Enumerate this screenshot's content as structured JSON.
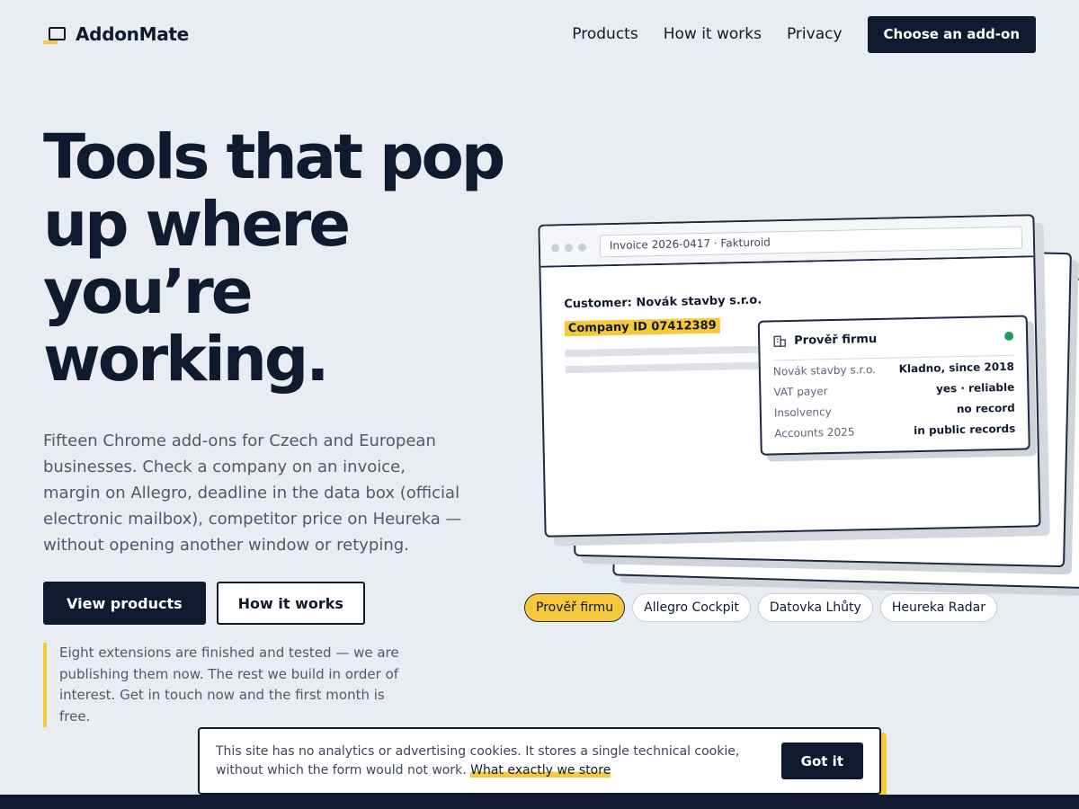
{
  "brand": {
    "name": "AddonMate"
  },
  "nav": {
    "items": [
      "Products",
      "How it works",
      "Privacy"
    ],
    "cta": "Choose an add-on"
  },
  "hero": {
    "title_lines": [
      "Tools that pop",
      "up where",
      "you’re",
      "working."
    ],
    "description": "Fifteen Chrome add-ons for Czech and European businesses. Check a company on an invoice, margin on Allegro, deadline in the data box (official electronic mailbox), competitor price on Heureka — without opening another window or retyping.",
    "primary_button": "View products",
    "secondary_button": "How it works",
    "note": "Eight extensions are finished and tested — we are publishing them now. The rest we build in order of interest. Get in touch now and the first month is free."
  },
  "illustration": {
    "url": "Invoice 2026-0417 · Fakturoid",
    "customer": "Customer: Novák stavby s.r.o.",
    "company_id": "Company ID 07412389",
    "popup": {
      "title": "Prověř firmu",
      "icon": "building-icon",
      "status_color": "#1f9d60",
      "rows": [
        {
          "key": "Novák stavby s.r.o.",
          "value": "Kladno, since 2018"
        },
        {
          "key": "VAT payer",
          "value": "yes · reliable"
        },
        {
          "key": "Insolvency",
          "value": "no record"
        },
        {
          "key": "Accounts 2025",
          "value": "in public records"
        }
      ]
    }
  },
  "chips": [
    {
      "label": "Prověř firmu",
      "active": true
    },
    {
      "label": "Allegro Cockpit",
      "active": false
    },
    {
      "label": "Datovka Lhůty",
      "active": false
    },
    {
      "label": "Heureka Radar",
      "active": false
    }
  ],
  "cookie": {
    "text": "This site has no analytics or advertising cookies. It stores a single technical cookie, without which the form would not work.",
    "link": "What exactly we store",
    "button": "Got it"
  },
  "colors": {
    "dark": "#0f1a2e",
    "accent": "#f5c93b",
    "background": "#e9ecf1",
    "ok": "#1f9d60"
  }
}
